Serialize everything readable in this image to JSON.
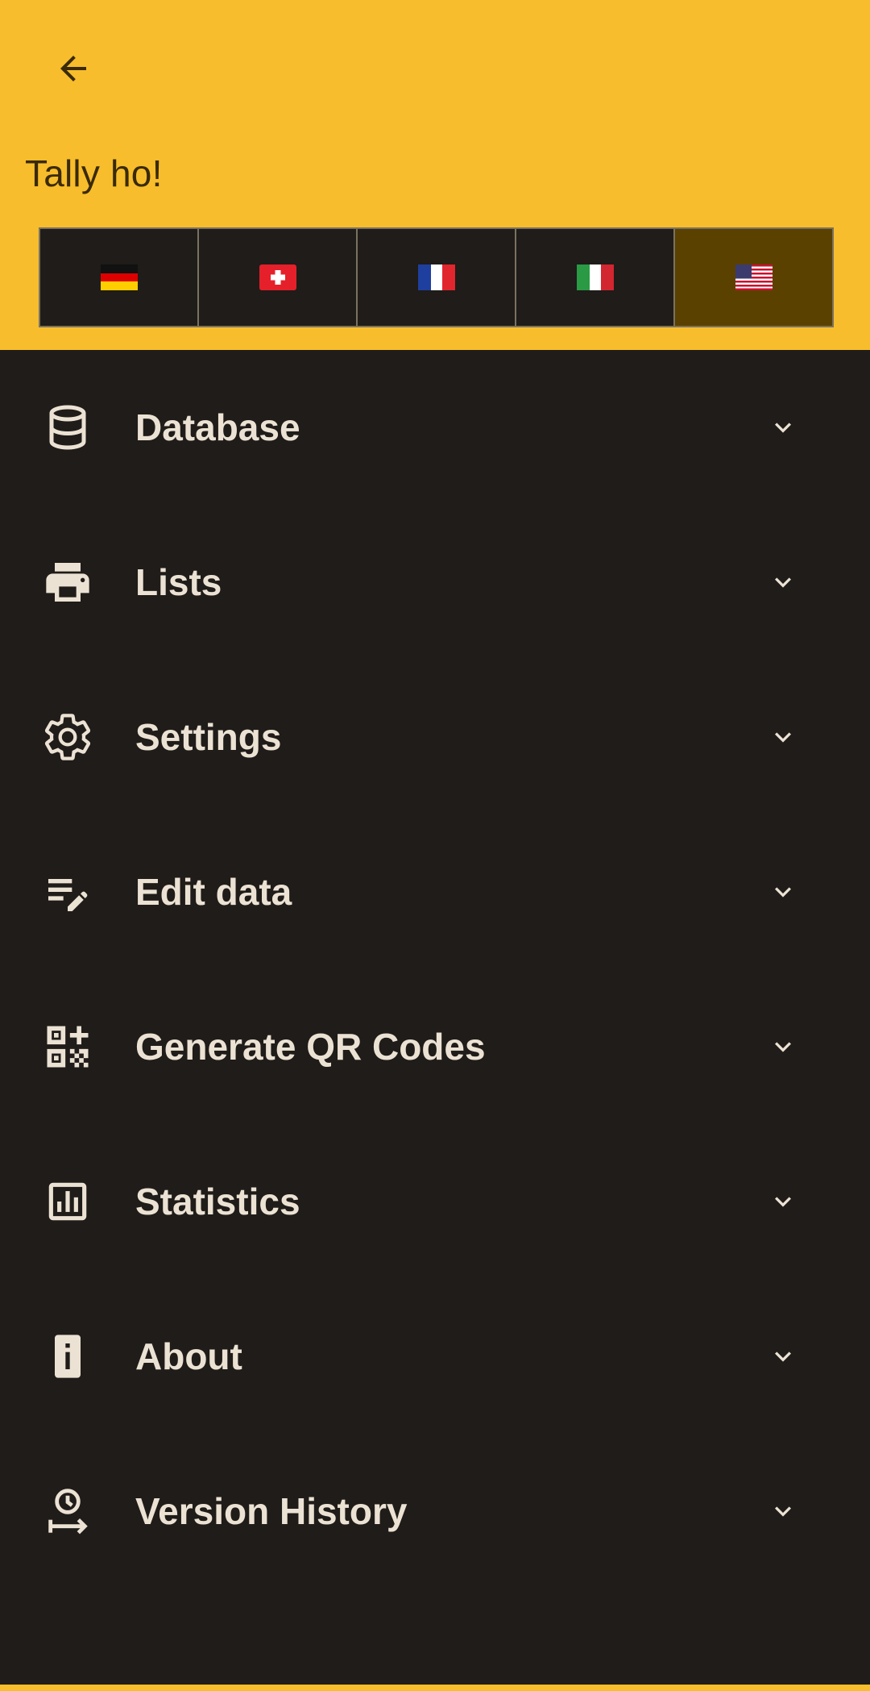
{
  "header": {
    "back_icon": "arrow-back-icon",
    "title": "Tally ho!",
    "background_color": "#f7bd2c"
  },
  "languages": [
    {
      "name": "german-flag-icon",
      "selected": false
    },
    {
      "name": "swiss-flag-icon",
      "selected": false
    },
    {
      "name": "french-flag-icon",
      "selected": false
    },
    {
      "name": "italian-flag-icon",
      "selected": false
    },
    {
      "name": "us-flag-icon",
      "selected": true
    }
  ],
  "menu": {
    "items": [
      {
        "label": "Database",
        "icon": "database-icon"
      },
      {
        "label": "Lists",
        "icon": "printer-icon"
      },
      {
        "label": "Settings",
        "icon": "gear-icon"
      },
      {
        "label": "Edit data",
        "icon": "edit-note-icon"
      },
      {
        "label": "Generate QR Codes",
        "icon": "qr-code-icon"
      },
      {
        "label": "Statistics",
        "icon": "bar-chart-icon"
      },
      {
        "label": "About",
        "icon": "info-icon"
      },
      {
        "label": "Version History",
        "icon": "history-icon"
      }
    ],
    "expand_icon": "chevron-down-icon"
  },
  "colors": {
    "accent": "#f7bd2c",
    "background": "#1f1c19",
    "text": "#ece2d4",
    "selected_language": "#5a4100"
  }
}
